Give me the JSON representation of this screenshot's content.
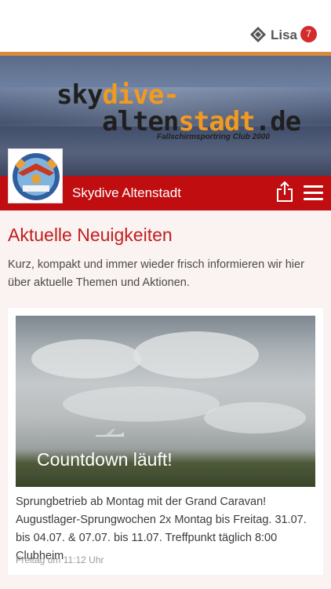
{
  "topbar": {
    "user_name": "Lisa",
    "badge_count": "7"
  },
  "header": {
    "logo_part1_a": "sky",
    "logo_part1_b": "dive-",
    "logo_part2_a": "alten",
    "logo_part2_b": "stadt",
    "logo_part2_c": ".de",
    "tagline": "Fallschirmsportring Club 2000"
  },
  "club_bar": {
    "name": "Skydive Altenstadt"
  },
  "section": {
    "title": "Aktuelle Neuigkeiten",
    "intro": "Kurz, kompakt und immer wieder frisch informieren wir hier über aktuelle Themen und Aktionen."
  },
  "news": [
    {
      "caption": "Countdown läuft!",
      "text": "Sprungbetrieb ab Montag mit der Grand Caravan! Augustlager-Sprungwochen 2x Montag bis Freitag. 31.07. bis 04.07. & 07.07. bis 11.07. Treffpunkt täglich 8:00 Clubheim",
      "meta": "Freitag um 11:12 Uhr"
    }
  ],
  "colors": {
    "accent": "#c00d10",
    "title": "#c0201f",
    "badge": "#d42c2c"
  },
  "icons": {
    "brand": "app-logo-icon",
    "share": "share-icon",
    "menu": "hamburger-menu-icon"
  }
}
